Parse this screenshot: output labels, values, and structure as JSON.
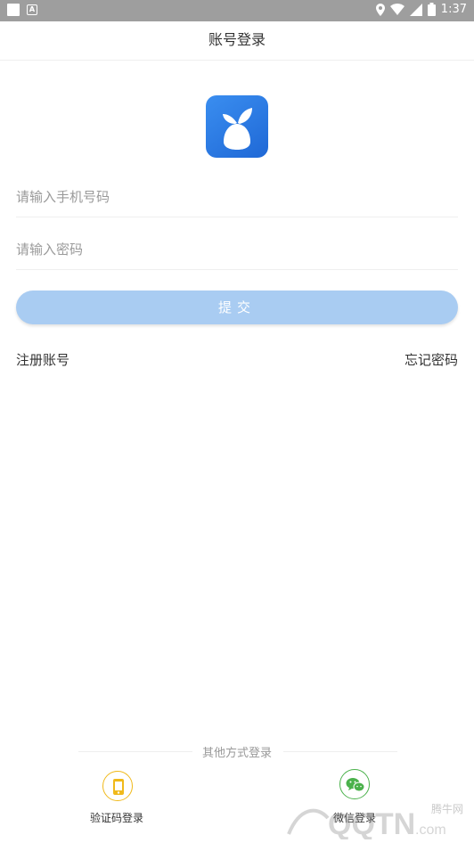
{
  "status_bar": {
    "time": "1:37"
  },
  "header": {
    "title": "账号登录"
  },
  "form": {
    "phone_placeholder": "请输入手机号码",
    "password_placeholder": "请输入密码",
    "submit_label": "提交"
  },
  "links": {
    "register": "注册账号",
    "forgot": "忘记密码"
  },
  "other_login": {
    "title": "其他方式登录",
    "options": [
      {
        "label": "验证码登录",
        "icon": "phone-icon",
        "color": "#f0b91a"
      },
      {
        "label": "微信登录",
        "icon": "wechat-icon",
        "color": "#4ab14b"
      }
    ]
  },
  "watermark": {
    "text": "腾牛网"
  },
  "colors": {
    "accent": "#a9ccf2",
    "logo": "#2a7be4"
  }
}
